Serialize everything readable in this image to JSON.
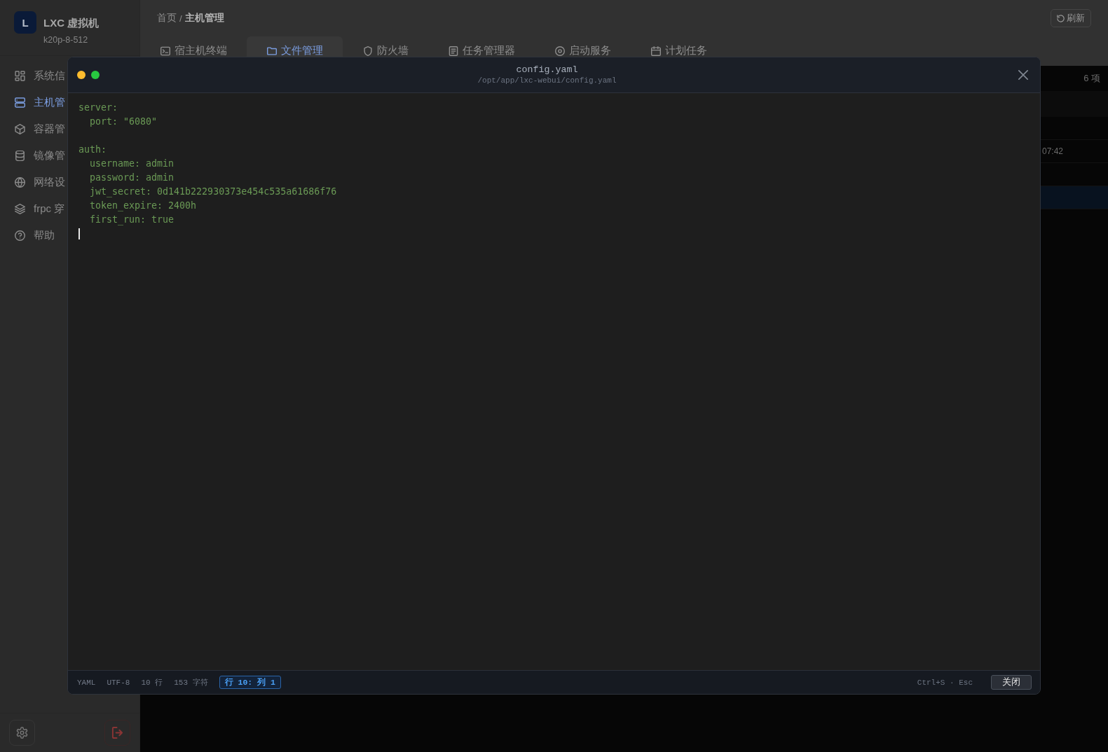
{
  "sidebar": {
    "logo": "L",
    "title": "LXC 虚拟机",
    "subtitle": "k20p-8-512",
    "items": [
      {
        "label": "系统信",
        "selected": false
      },
      {
        "label": "主机管",
        "selected": true
      },
      {
        "label": "容器管",
        "selected": false
      },
      {
        "label": "镜像管",
        "selected": false
      },
      {
        "label": "网络设",
        "selected": false
      },
      {
        "label": "frpc 穿",
        "selected": false
      },
      {
        "label": "帮助",
        "selected": false
      }
    ]
  },
  "header": {
    "breadcrumb": {
      "items": [
        {
          "label": "首页",
          "current": false
        },
        {
          "label": "主机管理",
          "current": true
        }
      ],
      "separator": "/"
    },
    "refresh_button": "刷新"
  },
  "tabs": [
    {
      "label": "宿主机终端",
      "selected": false
    },
    {
      "label": "文件管理",
      "selected": true
    },
    {
      "label": "防火墙",
      "selected": false
    },
    {
      "label": "任务管理器",
      "selected": false
    },
    {
      "label": "启动服务",
      "selected": false
    },
    {
      "label": "计划任务",
      "selected": false
    }
  ],
  "main": {
    "count": "6 项",
    "rows": [
      {
        "selected": false
      },
      {
        "time": "07:42",
        "selected": false
      },
      {
        "selected": false
      },
      {
        "selected": true
      }
    ]
  },
  "editor": {
    "title": "config.yaml",
    "path": "/opt/app/lxc-webui/config.yaml",
    "content": "server:\n  port: \"6080\"\n\nauth:\n  username: admin\n  password: admin\n  jwt_secret: 0d141b222930373e454c535a61686f76\n  token_expire: 2400h\n  first_run: true\n",
    "status": {
      "language": "YAML",
      "encoding": "UTF-8",
      "lines": "10 行",
      "chars": "153 字符",
      "position": "行 10: 列 1",
      "hint": "Ctrl+S · Esc"
    },
    "close_button": "关闭"
  }
}
